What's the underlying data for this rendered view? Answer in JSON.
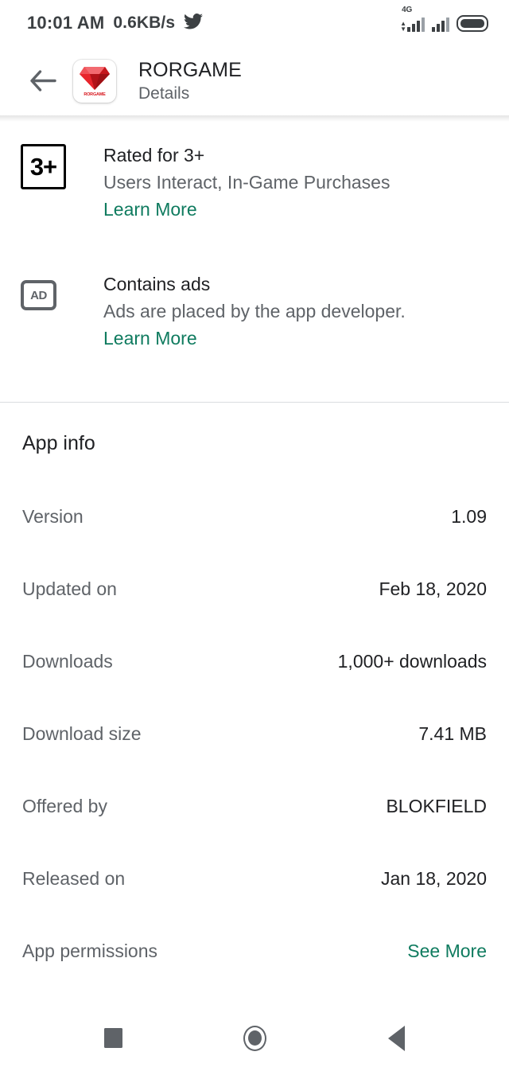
{
  "colors": {
    "link_green": "#0f7b5f",
    "text_primary": "#202124",
    "text_secondary": "#5f6368",
    "divider": "#dadce0",
    "icon_red": "#d81920"
  },
  "statusbar": {
    "time": "10:01 AM",
    "network_speed": "0.6KB/s",
    "twitter_icon": "twitter-bird-icon",
    "network_type": "4G",
    "signal_icon": "signal-bars-icon",
    "signal2_icon": "signal-bars-icon",
    "battery_icon": "battery-full-icon"
  },
  "header": {
    "back_icon": "back-arrow-icon",
    "app_icon": "rorgame-app-icon",
    "app_icon_label": "RORGAME",
    "title": "RORGAME",
    "subtitle": "Details"
  },
  "rating": {
    "badge_icon": "rating-3plus-icon",
    "badge_text": "3+",
    "title": "Rated for 3+",
    "subtitle": "Users Interact, In-Game Purchases",
    "learn_more": "Learn More"
  },
  "ads": {
    "badge_icon": "contains-ads-icon",
    "badge_text": "AD",
    "title": "Contains ads",
    "subtitle": "Ads are placed by the app developer.",
    "learn_more": "Learn More"
  },
  "app_info": {
    "section_title": "App info",
    "rows": [
      {
        "label": "Version",
        "value": "1.09",
        "is_link": false
      },
      {
        "label": "Updated on",
        "value": "Feb 18, 2020",
        "is_link": false
      },
      {
        "label": "Downloads",
        "value": "1,000+ downloads",
        "is_link": false
      },
      {
        "label": "Download size",
        "value": "7.41 MB",
        "is_link": false
      },
      {
        "label": "Offered by",
        "value": "BLOKFIELD",
        "is_link": false
      },
      {
        "label": "Released on",
        "value": "Jan 18, 2020",
        "is_link": false
      },
      {
        "label": "App permissions",
        "value": "See More",
        "is_link": true
      }
    ]
  },
  "navbar": {
    "recents_icon": "recents-square-icon",
    "home_icon": "home-circle-icon",
    "back_icon": "back-triangle-icon"
  }
}
